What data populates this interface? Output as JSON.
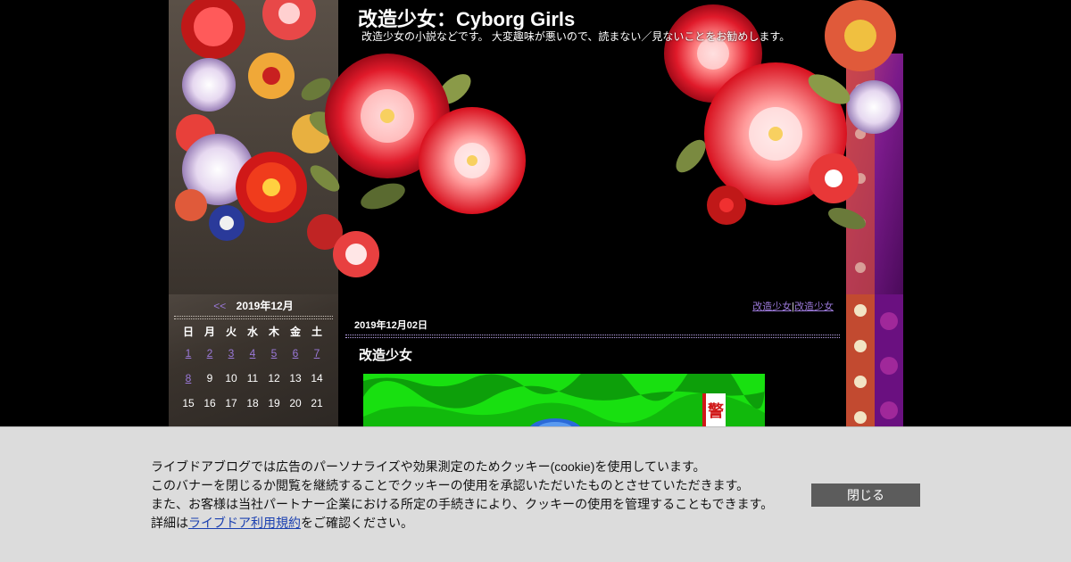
{
  "header": {
    "title": "改造少女：Cyborg Girls",
    "description": "改造少女の小説などです。 大変趣味が悪いので、読まない／見ないことをお勧めします。"
  },
  "calendar": {
    "prev_label": "<<",
    "month_label": "2019年12月",
    "weekdays": [
      "日",
      "月",
      "火",
      "水",
      "木",
      "金",
      "土"
    ],
    "rows": [
      [
        "1",
        "2",
        "3",
        "4",
        "5",
        "6",
        "7"
      ],
      [
        "8",
        "9",
        "10",
        "11",
        "12",
        "13",
        "14"
      ],
      [
        "15",
        "16",
        "17",
        "18",
        "19",
        "20",
        "21"
      ]
    ],
    "linked_days": [
      "1",
      "2",
      "3",
      "4",
      "5",
      "6",
      "7",
      "8"
    ]
  },
  "main": {
    "category_links": [
      "改造少女",
      "改造少女"
    ],
    "category_separator": "|",
    "entry_date": "2019年12月02日",
    "entry_title": "改造少女",
    "image_sign_char": "警"
  },
  "cookie": {
    "line1": "ライブドアブログでは広告のパーソナライズや効果測定のためクッキー(cookie)を使用しています。",
    "line2": "このバナーを閉じるか閲覧を継続することでクッキーの使用を承認いただいたものとさせていただきます。",
    "line3": "また、お客様は当社パートナー企業における所定の手続きにより、クッキーの使用を管理することもできます。",
    "line4_prefix": "詳細は",
    "line4_link": "ライブドア利用規約",
    "line4_suffix": "をご確認ください。",
    "close_label": "閉じる"
  },
  "colors": {
    "link": "#9a78d8",
    "banner_bg": "#dcdcdc",
    "close_button": "#5c5c5c",
    "entry_image_green": "#18e010"
  }
}
